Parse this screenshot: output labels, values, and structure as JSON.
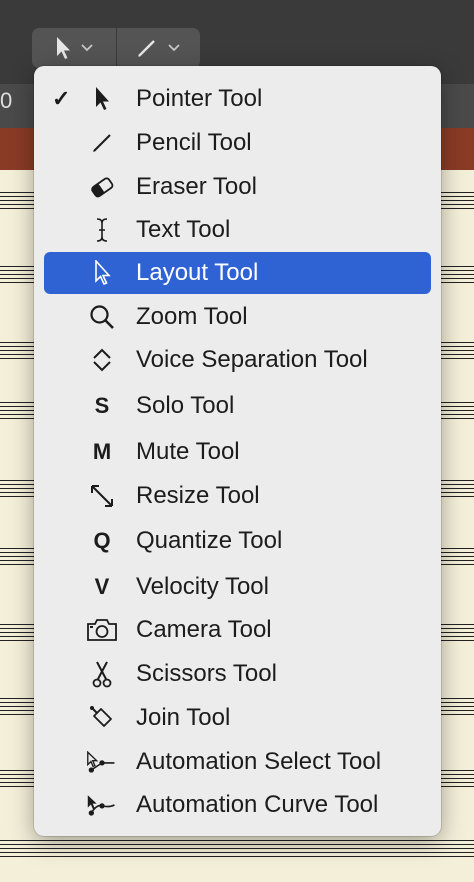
{
  "toolbar": {
    "left_tool": "pointer-icon",
    "right_tool": "pencil-icon",
    "position_readout": "0"
  },
  "menu": {
    "items": [
      {
        "label": "Pointer Tool",
        "icon": "pointer-icon",
        "checked": true,
        "selected": false
      },
      {
        "label": "Pencil Tool",
        "icon": "pencil-icon",
        "checked": false,
        "selected": false
      },
      {
        "label": "Eraser Tool",
        "icon": "eraser-icon",
        "checked": false,
        "selected": false
      },
      {
        "label": "Text Tool",
        "icon": "text-cursor-icon",
        "checked": false,
        "selected": false
      },
      {
        "label": "Layout Tool",
        "icon": "layout-pointer-icon",
        "checked": false,
        "selected": true
      },
      {
        "label": "Zoom Tool",
        "icon": "magnifier-icon",
        "checked": false,
        "selected": false
      },
      {
        "label": "Voice Separation Tool",
        "icon": "voice-separation-icon",
        "checked": false,
        "selected": false
      },
      {
        "label": "Solo Tool",
        "icon": "solo-icon",
        "glyph": "S",
        "checked": false,
        "selected": false
      },
      {
        "label": "Mute Tool",
        "icon": "mute-icon",
        "glyph": "M",
        "checked": false,
        "selected": false
      },
      {
        "label": "Resize Tool",
        "icon": "resize-icon",
        "checked": false,
        "selected": false
      },
      {
        "label": "Quantize Tool",
        "icon": "quantize-icon",
        "glyph": "Q",
        "checked": false,
        "selected": false
      },
      {
        "label": "Velocity Tool",
        "icon": "velocity-icon",
        "glyph": "V",
        "checked": false,
        "selected": false
      },
      {
        "label": "Camera Tool",
        "icon": "camera-icon",
        "checked": false,
        "selected": false
      },
      {
        "label": "Scissors Tool",
        "icon": "scissors-icon",
        "checked": false,
        "selected": false
      },
      {
        "label": "Join Tool",
        "icon": "join-icon",
        "checked": false,
        "selected": false
      },
      {
        "label": "Automation Select Tool",
        "icon": "automation-select-icon",
        "checked": false,
        "selected": false
      },
      {
        "label": "Automation Curve Tool",
        "icon": "automation-curve-icon",
        "checked": false,
        "selected": false
      }
    ],
    "check_glyph": "✓"
  },
  "colors": {
    "selection": "#2f63d4",
    "menu_bg": "#ececec",
    "toolbar_bg": "#3a3a3a"
  }
}
